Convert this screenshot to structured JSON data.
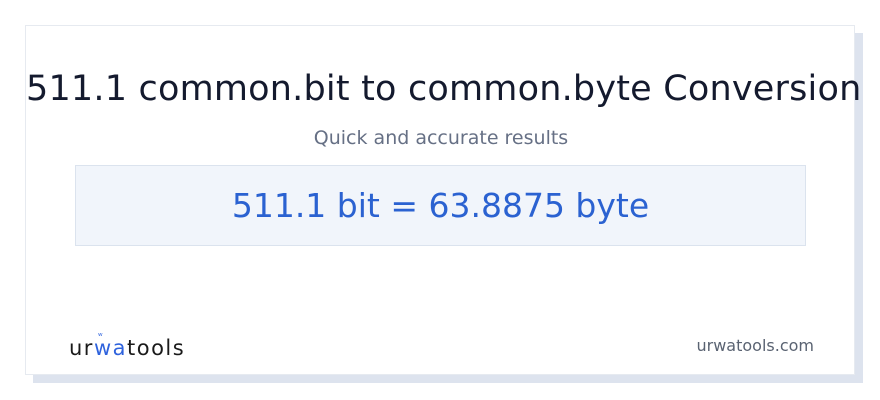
{
  "page": {
    "title": "511.1 common.bit to common.byte Conversion",
    "subtitle": "Quick and accurate results",
    "result": "511.1 bit = 63.8875 byte"
  },
  "footer": {
    "logo_prefix": "ur",
    "logo_accent": "wa",
    "logo_suffix": "tools",
    "site": "urwatools.com"
  },
  "colors": {
    "title": "#141a2e",
    "subtitle": "#667085",
    "result": "#2b62d1",
    "result_bg": "#f1f5fb",
    "logo_accent": "#2f63dd"
  }
}
